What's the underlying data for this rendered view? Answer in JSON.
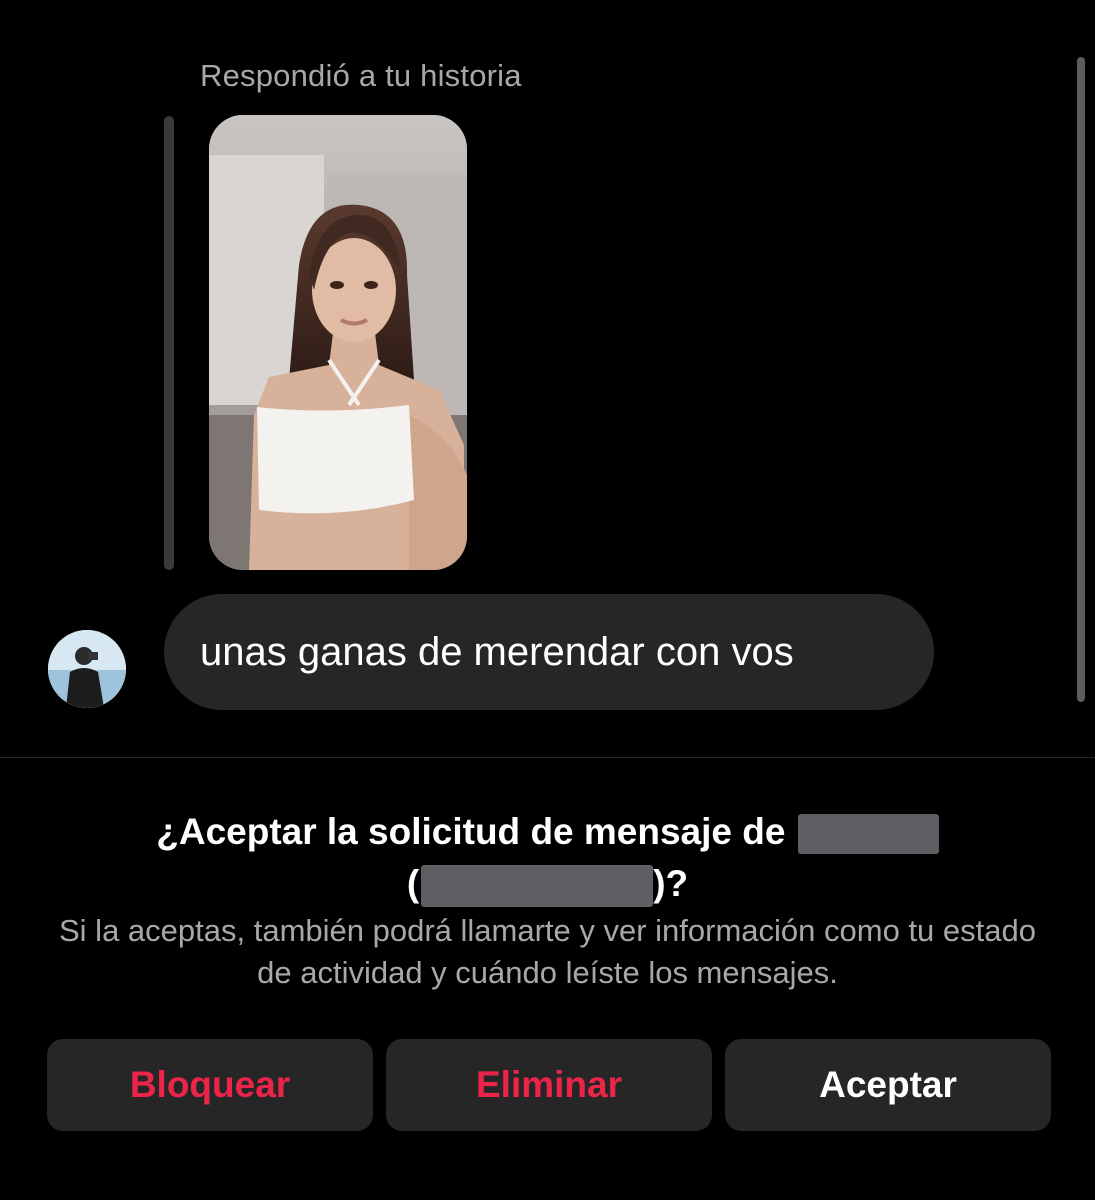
{
  "thread": {
    "reply_context_label": "Respondió a tu historia",
    "message_text": "unas ganas de merendar con vos"
  },
  "request": {
    "title_prefix": "¿Aceptar la solicitud de mensaje de ",
    "title_open_paren": "(",
    "title_suffix": ")?",
    "description": "Si la aceptas, también podrá llamarte y ver información como tu estado de actividad y cuándo leíste los mensajes."
  },
  "actions": {
    "block_label": "Bloquear",
    "delete_label": "Eliminar",
    "accept_label": "Aceptar"
  },
  "colors": {
    "background": "#000000",
    "bubble": "#262626",
    "button": "#262626",
    "destructive": "#ed2449",
    "secondary_text": "#a8a8a8"
  }
}
